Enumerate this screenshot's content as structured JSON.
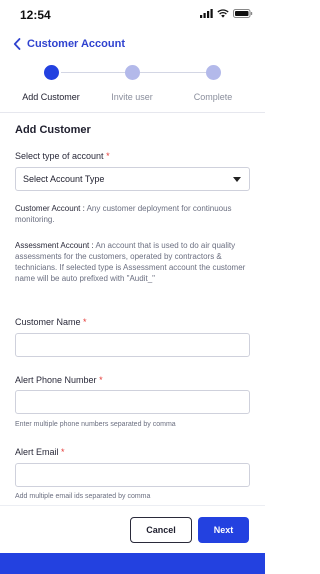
{
  "status_bar": {
    "time": "12:54"
  },
  "header": {
    "title": "Customer Account"
  },
  "stepper": {
    "steps": [
      {
        "label": "Add Customer",
        "state": "active"
      },
      {
        "label": "Invite user",
        "state": "inactive"
      },
      {
        "label": "Complete",
        "state": "inactive"
      }
    ],
    "active_color": "#2341e0",
    "inactive_color": "#b3b9ea"
  },
  "form": {
    "section_title": "Add Customer",
    "account_type": {
      "label": "Select type of account",
      "required_mark": "*",
      "selected_value": "Select Account Type"
    },
    "customer_account_desc": {
      "term": "Customer Account :",
      "text": " Any customer deployment for continuous monitoring."
    },
    "assessment_account_desc": {
      "term": "Assessment Account :",
      "text": " An account that is used to do air quality assessments for the customers, operated by contractors & technicians. If selected type is Assessment account the customer name will be auto prefixed with \"Audit_\""
    },
    "customer_name": {
      "label": "Customer Name",
      "required_mark": "*",
      "value": ""
    },
    "alert_phone": {
      "label": "Alert Phone Number",
      "required_mark": "*",
      "value": "",
      "hint": "Enter multiple phone numbers separated by comma"
    },
    "alert_email": {
      "label": "Alert Email",
      "required_mark": "*",
      "value": "",
      "hint": "Add multiple email ids separated by comma"
    }
  },
  "footer": {
    "cancel_label": "Cancel",
    "next_label": "Next"
  },
  "colors": {
    "primary": "#2341e0",
    "title": "#2f42cf",
    "required": "#e53935"
  }
}
